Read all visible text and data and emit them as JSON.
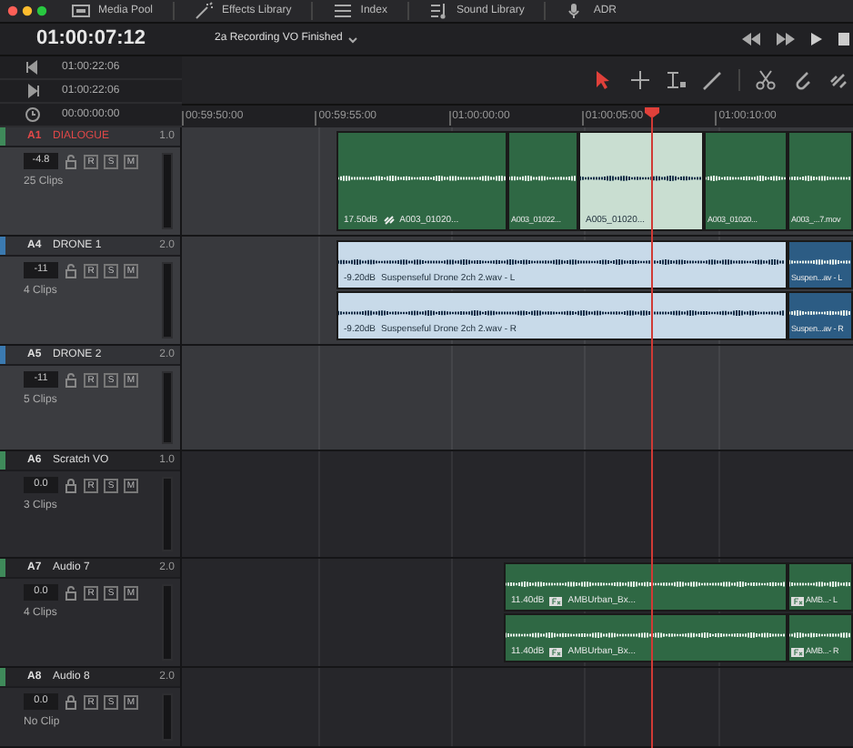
{
  "toolbar": {
    "items": [
      {
        "label": "Media Pool"
      },
      {
        "label": "Effects Library"
      },
      {
        "label": "Index"
      },
      {
        "label": "Sound Library"
      },
      {
        "label": "ADR"
      }
    ]
  },
  "timecode": "01:00:07:12",
  "timeline_name": "2a Recording VO Finished",
  "timecodes": [
    {
      "value": "01:00:22:06"
    },
    {
      "value": "01:00:22:06"
    },
    {
      "value": "00:00:00:00"
    }
  ],
  "tools": [
    {
      "selected": true
    },
    {
      "selected": false
    },
    {
      "selected": false
    },
    {
      "selected": false
    },
    {
      "selected": false
    },
    {
      "selected": false
    },
    {
      "selected": false
    }
  ],
  "ruler": [
    "00:59:50:00",
    "00:59:55:00",
    "01:00:00:00",
    "01:00:05:00",
    "01:00:10:00"
  ],
  "tracks": [
    {
      "id": "A1",
      "name": "DIALOGUE",
      "channels": "1.0",
      "volume": "-4.8",
      "clip_count": "25 Clips",
      "buttons": [
        "R",
        "S",
        "M"
      ],
      "selected": true,
      "highlighted": true,
      "locked": false,
      "color": "#3f8a5a",
      "lanes": [
        [
          {
            "gain": "17.50dB",
            "linked": true,
            "fx": false,
            "name": "A003_01020...",
            "selected": false
          },
          {
            "linked": false,
            "fx": false,
            "name": "A003_01022...",
            "selected": false
          },
          {
            "linked": false,
            "fx": false,
            "name": "A005_01020...",
            "selected": true
          },
          {
            "linked": false,
            "fx": false,
            "name": "A003_01020...",
            "selected": false
          },
          {
            "linked": false,
            "fx": false,
            "name": "A003_...7.mov",
            "selected": false
          }
        ]
      ]
    },
    {
      "id": "A4",
      "name": "DRONE 1",
      "channels": "2.0",
      "volume": "-11",
      "clip_count": "4 Clips",
      "buttons": [
        "R",
        "S",
        "M"
      ],
      "selected": false,
      "highlighted": true,
      "locked": false,
      "color": "#3b7ab0",
      "lanes": [
        [
          {
            "gain": "-9.20dB",
            "linked": false,
            "fx": false,
            "name": "Suspenseful Drone 2ch 2.wav - L",
            "selected": true
          },
          {
            "linked": false,
            "fx": false,
            "name": "Suspen...av - L",
            "selected": false
          }
        ],
        [
          {
            "gain": "-9.20dB",
            "linked": false,
            "fx": false,
            "name": "Suspenseful Drone 2ch 2.wav - R",
            "selected": true
          },
          {
            "linked": false,
            "fx": false,
            "name": "Suspen...av - R",
            "selected": false
          }
        ]
      ]
    },
    {
      "id": "A5",
      "name": "DRONE 2",
      "channels": "2.0",
      "volume": "-11",
      "clip_count": "5 Clips",
      "buttons": [
        "R",
        "S",
        "M"
      ],
      "selected": false,
      "highlighted": true,
      "locked": false,
      "color": "#3b7ab0"
    },
    {
      "id": "A6",
      "name": "Scratch VO",
      "channels": "1.0",
      "volume": "0.0",
      "clip_count": "3 Clips",
      "buttons": [
        "R",
        "S",
        "M"
      ],
      "selected": false,
      "highlighted": false,
      "locked": true,
      "color": "#3f8a5a"
    },
    {
      "id": "A7",
      "name": "Audio 7",
      "channels": "2.0",
      "volume": "0.0",
      "clip_count": "4 Clips",
      "buttons": [
        "R",
        "S",
        "M"
      ],
      "selected": false,
      "highlighted": false,
      "locked": false,
      "color": "#3f8a5a",
      "lanes": [
        [
          {
            "gain": "11.40dB",
            "linked": false,
            "fx": true,
            "name": "AMBUrban_Bx...",
            "selected": false
          },
          {
            "linked": false,
            "fx": true,
            "name": "AMB...- L",
            "selected": false
          }
        ],
        [
          {
            "gain": "11.40dB",
            "linked": false,
            "fx": true,
            "name": "AMBUrban_Bx...",
            "selected": false
          },
          {
            "linked": false,
            "fx": true,
            "name": "AMB...- R",
            "selected": false
          }
        ]
      ]
    },
    {
      "id": "A8",
      "name": "Audio 8",
      "channels": "2.0",
      "volume": "0.0",
      "clip_count": "No Clip",
      "buttons": [
        "R",
        "S",
        "M"
      ],
      "selected": false,
      "highlighted": false,
      "locked": true,
      "color": "#3f8a5a"
    }
  ]
}
